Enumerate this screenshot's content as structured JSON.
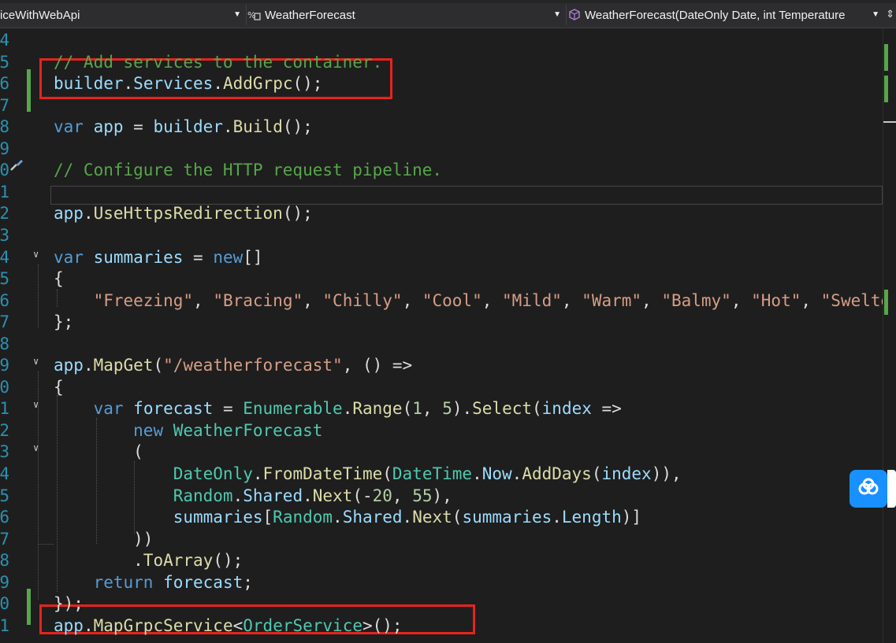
{
  "navbar": {
    "project": "iceWithWebApi",
    "type_scope": "WeatherForecast",
    "member_scope": "WeatherForecast(DateOnly Date, int Temperature"
  },
  "lines": [
    {
      "n": "4",
      "tokens": []
    },
    {
      "n": "5",
      "tokens": [
        [
          "cm",
          "// Add services to the container."
        ]
      ]
    },
    {
      "n": "6",
      "tokens": [
        [
          "va",
          "builder"
        ],
        [
          "pl",
          "."
        ],
        [
          "va",
          "Services"
        ],
        [
          "pl",
          "."
        ],
        [
          "me",
          "AddGrpc"
        ],
        [
          "pl",
          "();"
        ]
      ]
    },
    {
      "n": "7",
      "tokens": []
    },
    {
      "n": "8",
      "tokens": [
        [
          "kw",
          "var"
        ],
        [
          "pl",
          " "
        ],
        [
          "va",
          "app"
        ],
        [
          "pl",
          " = "
        ],
        [
          "va",
          "builder"
        ],
        [
          "pl",
          "."
        ],
        [
          "me",
          "Build"
        ],
        [
          "pl",
          "();"
        ]
      ]
    },
    {
      "n": "9",
      "tokens": []
    },
    {
      "n": "0",
      "tokens": [
        [
          "cm",
          "// Configure the HTTP request pipeline."
        ]
      ]
    },
    {
      "n": "1",
      "tokens": []
    },
    {
      "n": "2",
      "tokens": [
        [
          "va",
          "app"
        ],
        [
          "pl",
          "."
        ],
        [
          "me",
          "UseHttpsRedirection"
        ],
        [
          "pl",
          "();"
        ]
      ]
    },
    {
      "n": "3",
      "tokens": []
    },
    {
      "n": "4",
      "tokens": [
        [
          "kw",
          "var"
        ],
        [
          "pl",
          " "
        ],
        [
          "va",
          "summaries"
        ],
        [
          "pl",
          " = "
        ],
        [
          "kw",
          "new"
        ],
        [
          "pl",
          "[]"
        ]
      ]
    },
    {
      "n": "5",
      "tokens": [
        [
          "pl",
          "{"
        ]
      ]
    },
    {
      "n": "6",
      "tokens": [
        [
          "pl",
          "    "
        ],
        [
          "st",
          "\"Freezing\""
        ],
        [
          "pl",
          ", "
        ],
        [
          "st",
          "\"Bracing\""
        ],
        [
          "pl",
          ", "
        ],
        [
          "st",
          "\"Chilly\""
        ],
        [
          "pl",
          ", "
        ],
        [
          "st",
          "\"Cool\""
        ],
        [
          "pl",
          ", "
        ],
        [
          "st",
          "\"Mild\""
        ],
        [
          "pl",
          ", "
        ],
        [
          "st",
          "\"Warm\""
        ],
        [
          "pl",
          ", "
        ],
        [
          "st",
          "\"Balmy\""
        ],
        [
          "pl",
          ", "
        ],
        [
          "st",
          "\"Hot\""
        ],
        [
          "pl",
          ", "
        ],
        [
          "st",
          "\"Sweltering"
        ]
      ]
    },
    {
      "n": "7",
      "tokens": [
        [
          "pl",
          "};"
        ]
      ]
    },
    {
      "n": "8",
      "tokens": []
    },
    {
      "n": "9",
      "tokens": [
        [
          "va",
          "app"
        ],
        [
          "pl",
          "."
        ],
        [
          "me",
          "MapGet"
        ],
        [
          "pl",
          "("
        ],
        [
          "st",
          "\"/weatherforecast\""
        ],
        [
          "pl",
          ", () =>"
        ]
      ]
    },
    {
      "n": "0",
      "tokens": [
        [
          "pl",
          "{"
        ]
      ]
    },
    {
      "n": "1",
      "tokens": [
        [
          "pl",
          "    "
        ],
        [
          "kw",
          "var"
        ],
        [
          "pl",
          " "
        ],
        [
          "va",
          "forecast"
        ],
        [
          "pl",
          " = "
        ],
        [
          "ty",
          "Enumerable"
        ],
        [
          "pl",
          "."
        ],
        [
          "me",
          "Range"
        ],
        [
          "pl",
          "("
        ],
        [
          "nu",
          "1"
        ],
        [
          "pl",
          ", "
        ],
        [
          "nu",
          "5"
        ],
        [
          "pl",
          ")."
        ],
        [
          "me",
          "Select"
        ],
        [
          "pl",
          "("
        ],
        [
          "va",
          "index"
        ],
        [
          "pl",
          " =>"
        ]
      ]
    },
    {
      "n": "2",
      "tokens": [
        [
          "pl",
          "        "
        ],
        [
          "kw",
          "new"
        ],
        [
          "pl",
          " "
        ],
        [
          "ty",
          "WeatherForecast"
        ]
      ]
    },
    {
      "n": "3",
      "tokens": [
        [
          "pl",
          "        ("
        ]
      ]
    },
    {
      "n": "4",
      "tokens": [
        [
          "pl",
          "            "
        ],
        [
          "ty",
          "DateOnly"
        ],
        [
          "pl",
          "."
        ],
        [
          "me",
          "FromDateTime"
        ],
        [
          "pl",
          "("
        ],
        [
          "ty",
          "DateTime"
        ],
        [
          "pl",
          "."
        ],
        [
          "va",
          "Now"
        ],
        [
          "pl",
          "."
        ],
        [
          "me",
          "AddDays"
        ],
        [
          "pl",
          "("
        ],
        [
          "va",
          "index"
        ],
        [
          "pl",
          ")),"
        ]
      ]
    },
    {
      "n": "5",
      "tokens": [
        [
          "pl",
          "            "
        ],
        [
          "ty",
          "Random"
        ],
        [
          "pl",
          "."
        ],
        [
          "va",
          "Shared"
        ],
        [
          "pl",
          "."
        ],
        [
          "me",
          "Next"
        ],
        [
          "pl",
          "(-"
        ],
        [
          "nu",
          "20"
        ],
        [
          "pl",
          ", "
        ],
        [
          "nu",
          "55"
        ],
        [
          "pl",
          "),"
        ]
      ]
    },
    {
      "n": "6",
      "tokens": [
        [
          "pl",
          "            "
        ],
        [
          "va",
          "summaries"
        ],
        [
          "pl",
          "["
        ],
        [
          "ty",
          "Random"
        ],
        [
          "pl",
          "."
        ],
        [
          "va",
          "Shared"
        ],
        [
          "pl",
          "."
        ],
        [
          "me",
          "Next"
        ],
        [
          "pl",
          "("
        ],
        [
          "va",
          "summaries"
        ],
        [
          "pl",
          "."
        ],
        [
          "va",
          "Length"
        ],
        [
          "pl",
          ")]"
        ]
      ]
    },
    {
      "n": "7",
      "tokens": [
        [
          "pl",
          "        ))"
        ]
      ]
    },
    {
      "n": "8",
      "tokens": [
        [
          "pl",
          "        ."
        ],
        [
          "me",
          "ToArray"
        ],
        [
          "pl",
          "();"
        ]
      ]
    },
    {
      "n": "9",
      "tokens": [
        [
          "pl",
          "    "
        ],
        [
          "kw",
          "return"
        ],
        [
          "pl",
          " "
        ],
        [
          "va",
          "forecast"
        ],
        [
          "pl",
          ";"
        ]
      ]
    },
    {
      "n": "0",
      "tokens": [
        [
          "pl",
          "});"
        ]
      ]
    },
    {
      "n": "1",
      "tokens": [
        [
          "va",
          "app"
        ],
        [
          "pl",
          "."
        ],
        [
          "me",
          "MapGrpcService"
        ],
        [
          "pl",
          "<"
        ],
        [
          "ty",
          "OrderService"
        ],
        [
          "pl",
          ">();"
        ]
      ]
    }
  ],
  "icons": {
    "navbar_project": "csharp-project-icon",
    "navbar_type": "class-icon",
    "navbar_member": "member-cube-icon",
    "quick_action": "screwdriver-icon",
    "floating": "cloud-assistant-icon"
  },
  "colors": {
    "annotation": "#e8231d",
    "change_bar": "#57a64a"
  }
}
